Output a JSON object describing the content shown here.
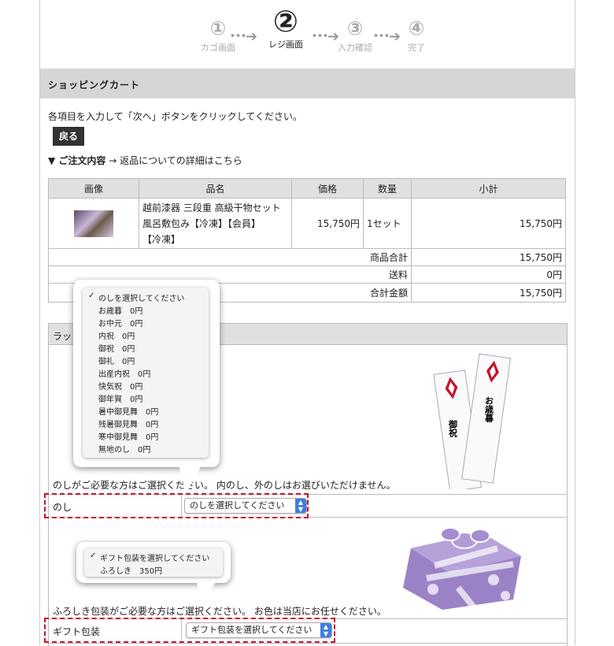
{
  "steps": [
    {
      "num": "①",
      "label": "カゴ画面"
    },
    {
      "num": "②",
      "label": "レジ画面"
    },
    {
      "num": "③",
      "label": "入力確認"
    },
    {
      "num": "④",
      "label": "完了"
    }
  ],
  "arrow": "･･･➔",
  "section_title": "ショッピングカート",
  "instruction": "各項目を入力して「次へ」ボタンをクリックしてください。",
  "back_button": "戻る",
  "order": {
    "title": "▼ ご注文内容",
    "link": "→ 返品についての詳細はこちら"
  },
  "cart": {
    "headers": [
      "画像",
      "品名",
      "価格",
      "数量",
      "小計"
    ],
    "item": {
      "name_line1": "越前漆器 三段重 高級干物セット",
      "name_line2": "風呂敷包み【冷凍】【会員】",
      "name_line3": "【冷凍】",
      "price": "15,750円",
      "qty": "1セット",
      "subtotal": "15,750円"
    },
    "totals": [
      {
        "label": "商品合計",
        "value": "15,750円"
      },
      {
        "label": "送料",
        "value": "0円"
      },
      {
        "label": "合計金額",
        "value": "15,750円"
      }
    ]
  },
  "wrapping": {
    "header": "ラッ",
    "noshi_note": "のしがご必要な方はご選択ください。 内のし、外のしはお選びいただけません。",
    "noshi_label": "のし",
    "noshi_select": "のしを選択してください",
    "gift_note": "ふろしき包装がご必要な方はご選択ください。 お色は当店にお任せください。",
    "gift_label": "ギフト包装",
    "gift_select": "ギフト包装を選択してください"
  },
  "noshi_menu": {
    "checked": "✓",
    "items": [
      "のしを選択してください",
      "お歳暮　0円",
      "お中元　0円",
      "内祝　0円",
      "御祝　0円",
      "御礼　0円",
      "出産内祝　0円",
      "快気祝　0円",
      "御年賀　0円",
      "暑中御見舞　0円",
      "残暑御見舞　0円",
      "寒中御見舞　0円",
      "無地のし　0円"
    ]
  },
  "gift_menu": {
    "checked": "✓",
    "items": [
      "ギフト包装を選択してください",
      "ふろしき　350円"
    ]
  },
  "noshi_image": {
    "left_text": "御祝",
    "right_text": "お歳暮"
  },
  "colors": {
    "accent": "#c8102e",
    "select_blue": "#3b7fe0",
    "header_gray": "#d6d6d6"
  }
}
